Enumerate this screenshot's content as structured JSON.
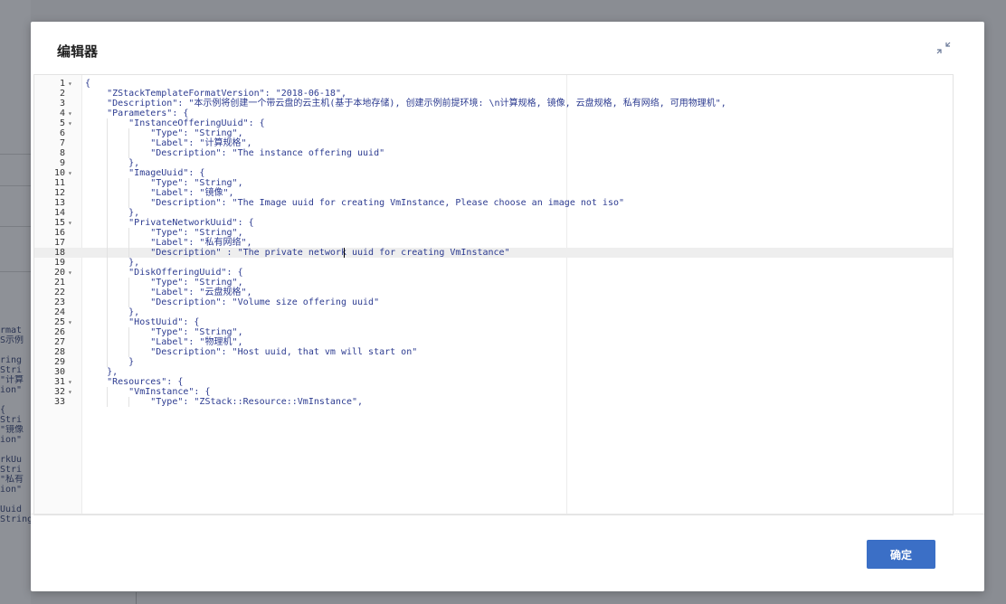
{
  "modal": {
    "title": "编辑器",
    "confirm_label": "确定",
    "collapse_icon": "collapse-icon"
  },
  "editor": {
    "active_line": 18,
    "lines": [
      {
        "n": "1",
        "fold": true,
        "indent": 0,
        "text": "{"
      },
      {
        "n": "2",
        "fold": false,
        "indent": 1,
        "text": "\"ZStackTemplateFormatVersion\": \"2018-06-18\","
      },
      {
        "n": "3",
        "fold": false,
        "indent": 1,
        "text": "\"Description\": \"本示例将创建一个带云盘的云主机(基于本地存储), 创建示例前提环境: \\n计算规格, 镜像, 云盘规格, 私有网络, 可用物理机\","
      },
      {
        "n": "4",
        "fold": true,
        "indent": 1,
        "text": "\"Parameters\": {"
      },
      {
        "n": "5",
        "fold": true,
        "indent": 2,
        "text": "\"InstanceOfferingUuid\": {"
      },
      {
        "n": "6",
        "fold": false,
        "indent": 3,
        "text": "\"Type\": \"String\","
      },
      {
        "n": "7",
        "fold": false,
        "indent": 3,
        "text": "\"Label\": \"计算规格\","
      },
      {
        "n": "8",
        "fold": false,
        "indent": 3,
        "text": "\"Description\": \"The instance offering uuid\""
      },
      {
        "n": "9",
        "fold": false,
        "indent": 2,
        "text": "},"
      },
      {
        "n": "10",
        "fold": true,
        "indent": 2,
        "text": "\"ImageUuid\": {"
      },
      {
        "n": "11",
        "fold": false,
        "indent": 3,
        "text": "\"Type\": \"String\","
      },
      {
        "n": "12",
        "fold": false,
        "indent": 3,
        "text": "\"Label\": \"镜像\","
      },
      {
        "n": "13",
        "fold": false,
        "indent": 3,
        "text": "\"Description\": \"The Image uuid for creating VmInstance, Please choose an image not iso\""
      },
      {
        "n": "14",
        "fold": false,
        "indent": 2,
        "text": "},"
      },
      {
        "n": "15",
        "fold": true,
        "indent": 2,
        "text": "\"PrivateNetworkUuid\": {"
      },
      {
        "n": "16",
        "fold": false,
        "indent": 3,
        "text": "\"Type\": \"String\","
      },
      {
        "n": "17",
        "fold": false,
        "indent": 3,
        "text": "\"Label\": \"私有网络\","
      },
      {
        "n": "18",
        "fold": false,
        "indent": 3,
        "text": "\"Description\" : \"The private network uuid for creating VmInstance\""
      },
      {
        "n": "19",
        "fold": false,
        "indent": 2,
        "text": "},"
      },
      {
        "n": "20",
        "fold": true,
        "indent": 2,
        "text": "\"DiskOfferingUuid\": {"
      },
      {
        "n": "21",
        "fold": false,
        "indent": 3,
        "text": "\"Type\": \"String\","
      },
      {
        "n": "22",
        "fold": false,
        "indent": 3,
        "text": "\"Label\": \"云盘规格\","
      },
      {
        "n": "23",
        "fold": false,
        "indent": 3,
        "text": "\"Description\": \"Volume size offering uuid\""
      },
      {
        "n": "24",
        "fold": false,
        "indent": 2,
        "text": "},"
      },
      {
        "n": "25",
        "fold": true,
        "indent": 2,
        "text": "\"HostUuid\": {"
      },
      {
        "n": "26",
        "fold": false,
        "indent": 3,
        "text": "\"Type\": \"String\","
      },
      {
        "n": "27",
        "fold": false,
        "indent": 3,
        "text": "\"Label\": \"物理机\","
      },
      {
        "n": "28",
        "fold": false,
        "indent": 3,
        "text": "\"Description\": \"Host uuid, that vm will start on\""
      },
      {
        "n": "29",
        "fold": false,
        "indent": 2,
        "text": "}"
      },
      {
        "n": "30",
        "fold": false,
        "indent": 1,
        "text": "},"
      },
      {
        "n": "31",
        "fold": true,
        "indent": 1,
        "text": "\"Resources\": {"
      },
      {
        "n": "32",
        "fold": true,
        "indent": 2,
        "text": "\"VmInstance\": {"
      },
      {
        "n": "33",
        "fold": false,
        "indent": 3,
        "text": "\"Type\": \"ZStack::Resource::VmInstance\","
      }
    ]
  },
  "background": {
    "code_lines": [
      "rmat",
      "S示例",
      "",
      "ring",
      "Stri",
      "\"计算",
      "ion\"",
      "",
      "{",
      "Stri",
      "\"镜像",
      "ion\"",
      "",
      "rkUu",
      "Stri",
      "\"私有",
      "ion\"",
      "",
      "Uuid",
      "String,"
    ]
  }
}
